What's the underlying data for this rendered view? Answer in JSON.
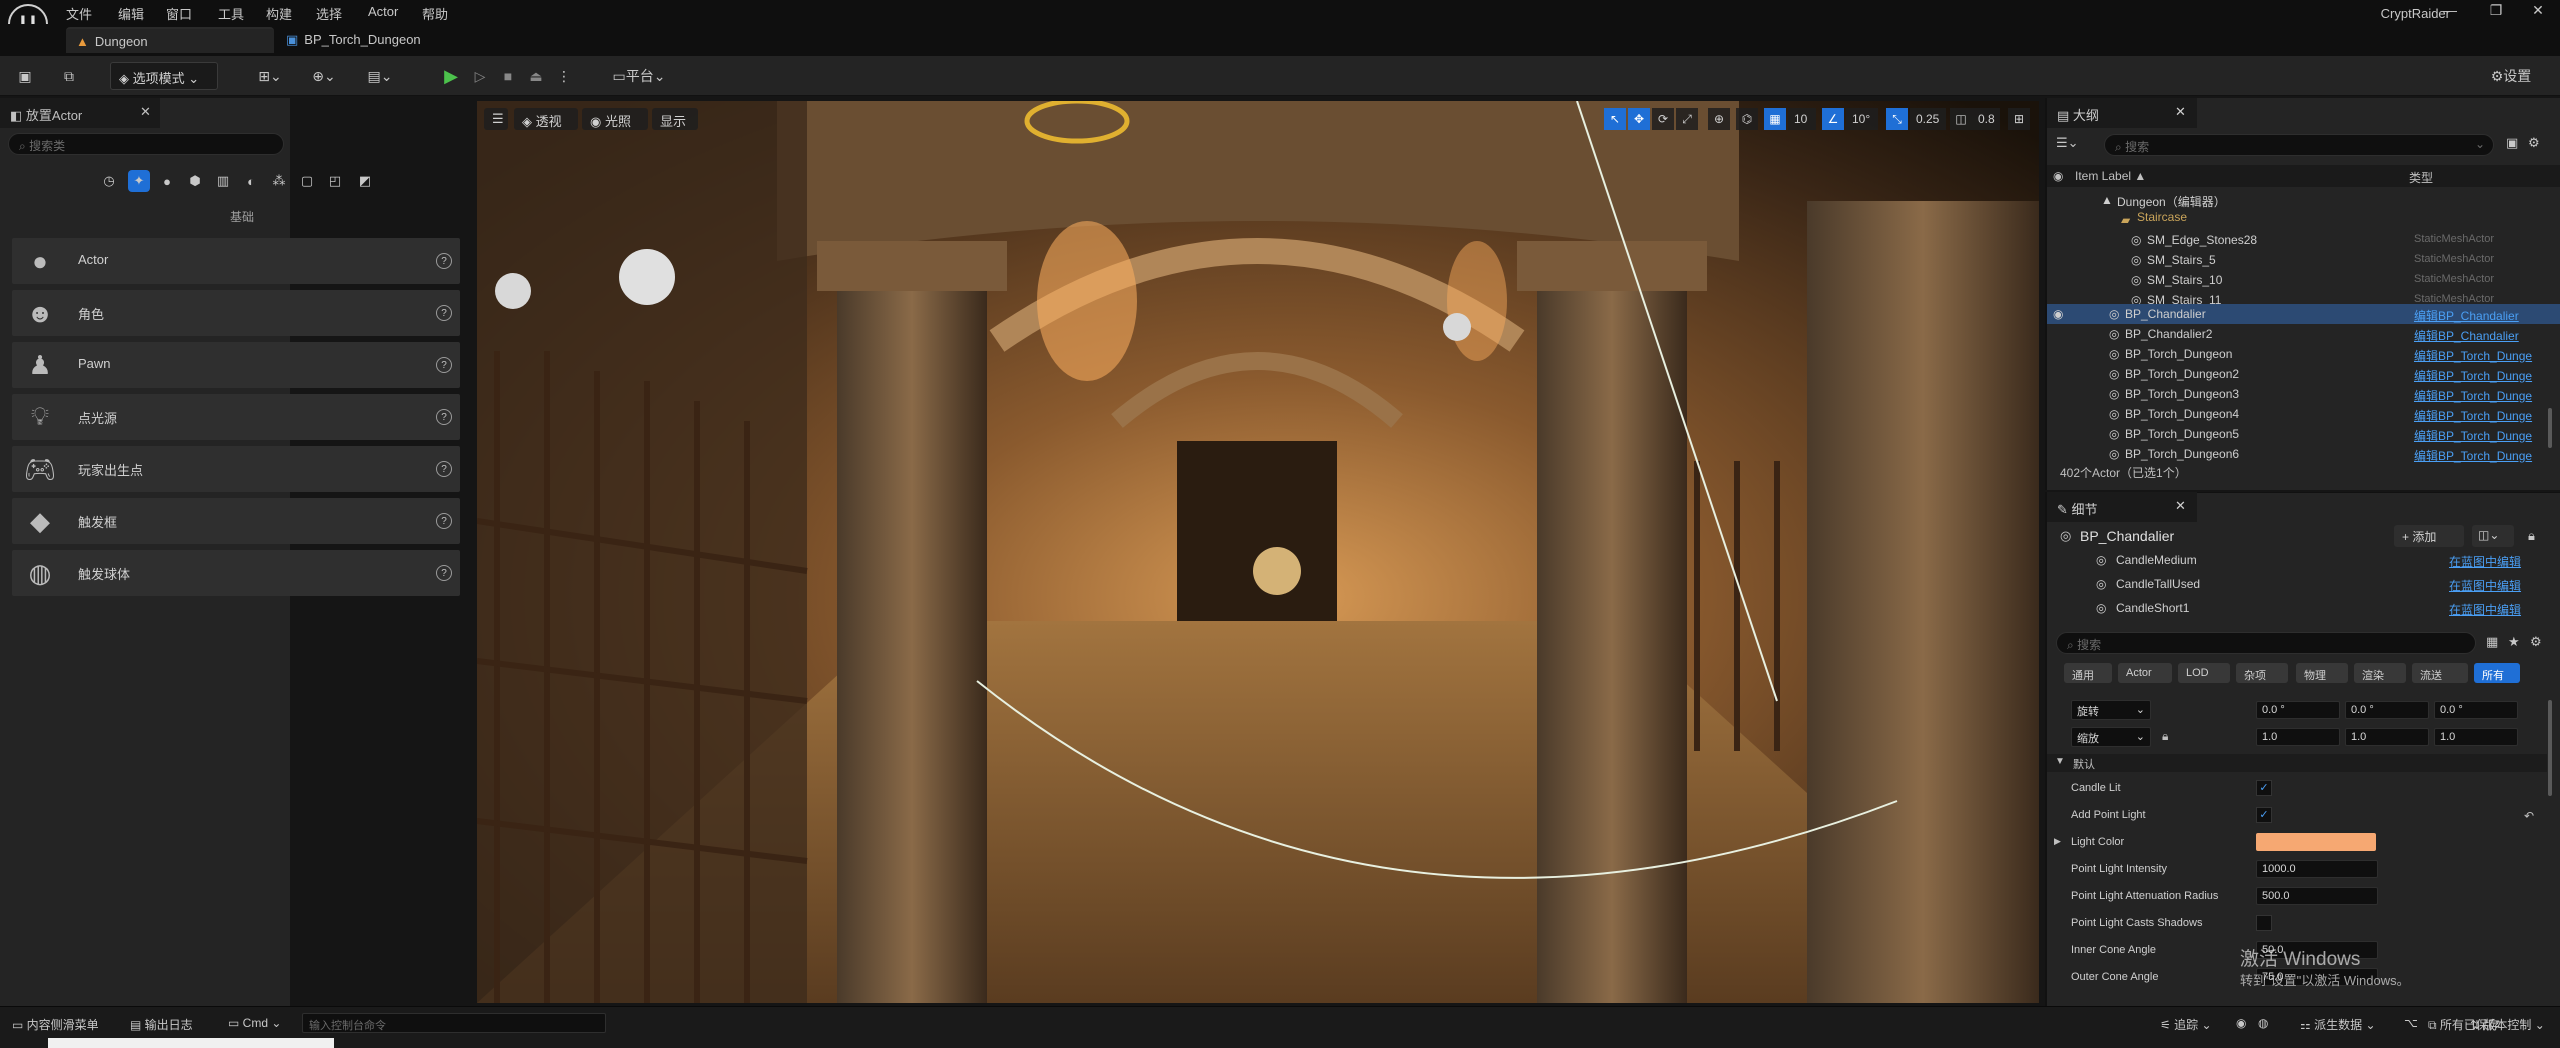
{
  "app": {
    "logo": "U",
    "title": "CryptRaider",
    "menu": [
      "文件",
      "编辑",
      "窗口",
      "工具",
      "构建",
      "选择",
      "Actor",
      "帮助"
    ],
    "window_controls": [
      "—",
      "❐",
      "✕"
    ]
  },
  "tabs": [
    {
      "label": "Dungeon",
      "icon": "level-icon"
    },
    {
      "label": "BP_Torch_Dungeon",
      "icon": "blueprint-icon"
    }
  ],
  "toolbar": {
    "mode": "选项模式",
    "platform": "平台",
    "settings": "设置"
  },
  "place_actors": {
    "title": "放置Actor",
    "search_placeholder": "搜索类",
    "category": "基础",
    "items": [
      {
        "label": "Actor",
        "icon": "sphere-icon"
      },
      {
        "label": "角色",
        "icon": "character-icon"
      },
      {
        "label": "Pawn",
        "icon": "pawn-icon"
      },
      {
        "label": "点光源",
        "icon": "bulb-icon"
      },
      {
        "label": "玩家出生点",
        "icon": "gamepad-icon"
      },
      {
        "label": "触发框",
        "icon": "box-icon"
      },
      {
        "label": "触发球体",
        "icon": "sphere-trigger-icon"
      }
    ]
  },
  "viewport": {
    "perspective": "透视",
    "lighting": "光照",
    "show": "显示",
    "grid_snap": "10",
    "rot_snap": "10°",
    "scale_snap": "0.25",
    "cam_speed": "0.8"
  },
  "outliner": {
    "title": "大纲",
    "search_placeholder": "搜索",
    "col_label": "Item Label ▲",
    "col_type": "类型",
    "rows": [
      {
        "label": "Dungeon（编辑器）",
        "type": "",
        "link": false
      },
      {
        "label": "Staircase",
        "type": "",
        "link": false
      },
      {
        "label": "SM_Edge_Stones28",
        "type": "StaticMeshActor",
        "link": false
      },
      {
        "label": "SM_Stairs_5",
        "type": "StaticMeshActor",
        "link": false
      },
      {
        "label": "SM_Stairs_10",
        "type": "StaticMeshActor",
        "link": false
      },
      {
        "label": "SM_Stairs_11",
        "type": "StaticMeshActor",
        "link": false
      },
      {
        "label": "BP_Chandalier",
        "type": "编辑BP_Chandalier",
        "link": true,
        "selected": true
      },
      {
        "label": "BP_Chandalier2",
        "type": "编辑BP_Chandalier",
        "link": true
      },
      {
        "label": "BP_Torch_Dungeon",
        "type": "编辑BP_Torch_Dunge",
        "link": true
      },
      {
        "label": "BP_Torch_Dungeon2",
        "type": "编辑BP_Torch_Dunge",
        "link": true
      },
      {
        "label": "BP_Torch_Dungeon3",
        "type": "编辑BP_Torch_Dunge",
        "link": true
      },
      {
        "label": "BP_Torch_Dungeon4",
        "type": "编辑BP_Torch_Dunge",
        "link": true
      },
      {
        "label": "BP_Torch_Dungeon5",
        "type": "编辑BP_Torch_Dunge",
        "link": true
      },
      {
        "label": "BP_Torch_Dungeon6",
        "type": "编辑BP_Torch_Dunge",
        "link": true
      }
    ],
    "count": "402个Actor（已选1个）"
  },
  "details": {
    "tab": "细节",
    "title": "BP_Chandalier",
    "add": "+ 添加",
    "components": [
      {
        "label": "CandleMedium",
        "link": "在蓝图中编辑"
      },
      {
        "label": "CandleTallUsed",
        "link": "在蓝图中编辑"
      },
      {
        "label": "CandleShort1",
        "link": "在蓝图中编辑"
      }
    ],
    "search_placeholder": "搜索",
    "categories": [
      "通用",
      "Actor",
      "LOD",
      "杂项",
      "物理",
      "渲染",
      "流送",
      "所有"
    ],
    "rotation_label": "旋转",
    "rotation": [
      "0.0 °",
      "0.0 °",
      "0.0 °"
    ],
    "scale_label": "缩放",
    "scale": [
      "1.0",
      "1.0",
      "1.0"
    ],
    "default_section": "默认",
    "props": [
      {
        "label": "Candle Lit",
        "kind": "check",
        "value": "✓"
      },
      {
        "label": "Add Point Light",
        "kind": "check",
        "value": "✓"
      },
      {
        "label": "Light Color",
        "kind": "color",
        "value": "#f6a872"
      },
      {
        "label": "Point Light Intensity",
        "kind": "num",
        "value": "1000.0"
      },
      {
        "label": "Point Light Attenuation Radius",
        "kind": "num",
        "value": "500.0"
      },
      {
        "label": "Point Light Casts Shadows",
        "kind": "check",
        "value": ""
      },
      {
        "label": "Inner Cone Angle",
        "kind": "num",
        "value": "50.0"
      },
      {
        "label": "Outer Cone Angle",
        "kind": "num",
        "value": "75.0"
      }
    ]
  },
  "watermark": {
    "line1": "激活 Windows",
    "line2": "转到\"设置\"以激活 Windows。"
  },
  "statusbar": {
    "content_drawer": "内容侧滑菜单",
    "output_log": "输出日志",
    "cmd": "Cmd",
    "cmd_placeholder": "输入控制台命令",
    "trace": "追踪",
    "derived_data": "派生数据",
    "all_saved": "所有已保存",
    "source_control": "版本控制"
  },
  "colors": {
    "accent": "#1f6fd6",
    "play": "#4cc24c",
    "link": "#4a9ff5"
  }
}
